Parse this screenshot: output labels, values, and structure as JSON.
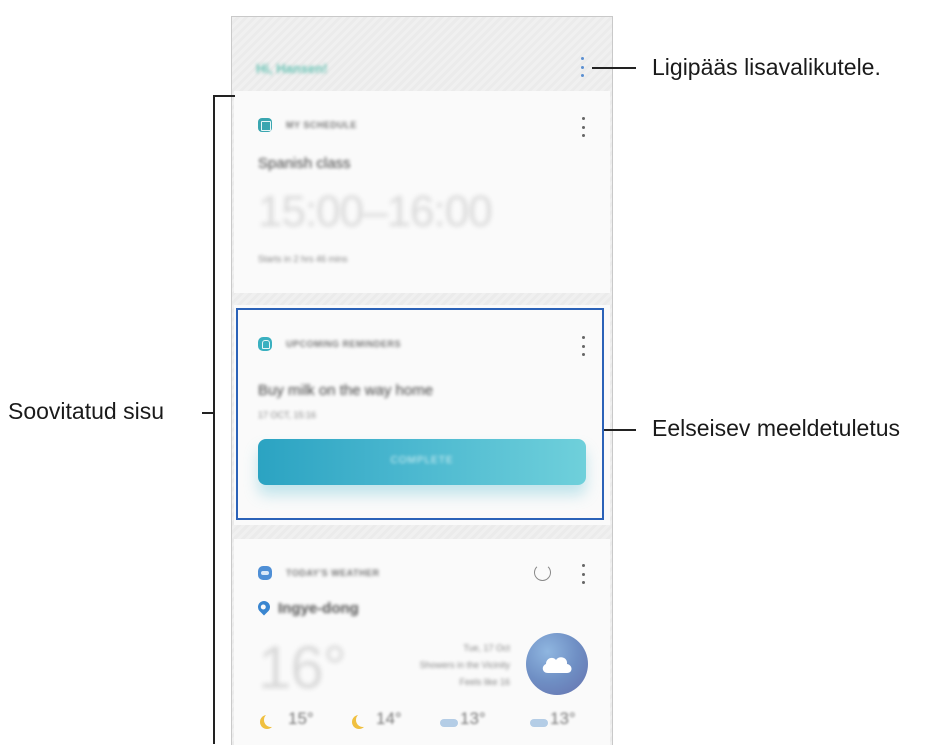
{
  "annotations": {
    "options": "Ligipääs lisavalikutele.",
    "recommended": "Soovitatud sisu",
    "reminder": "Eelseisev meeldetuletus"
  },
  "phone": {
    "greeting": "Hi, Hansen!",
    "schedule": {
      "header": "MY SCHEDULE",
      "title": "Spanish class",
      "time": "15:00–16:00",
      "sub": "Starts in 2 hrs 46 mins"
    },
    "reminder": {
      "header": "UPCOMING REMINDERS",
      "title": "Buy milk on the way home",
      "date": "17 OCT, 15:16",
      "button": "COMPLETE"
    },
    "weather": {
      "header": "TODAY'S WEATHER",
      "location": "Ingye-dong",
      "temp": "16°",
      "line1": "Tue, 17 Oct",
      "line2": "Showers in the Vicinity",
      "line3": "Feels like 16",
      "forecast": [
        "15°",
        "14°",
        "13°",
        "13°"
      ]
    }
  },
  "colors": {
    "accent": "#2b62b8",
    "teal": "#4ab7cf",
    "weather_icon": "#6f8fc4"
  }
}
